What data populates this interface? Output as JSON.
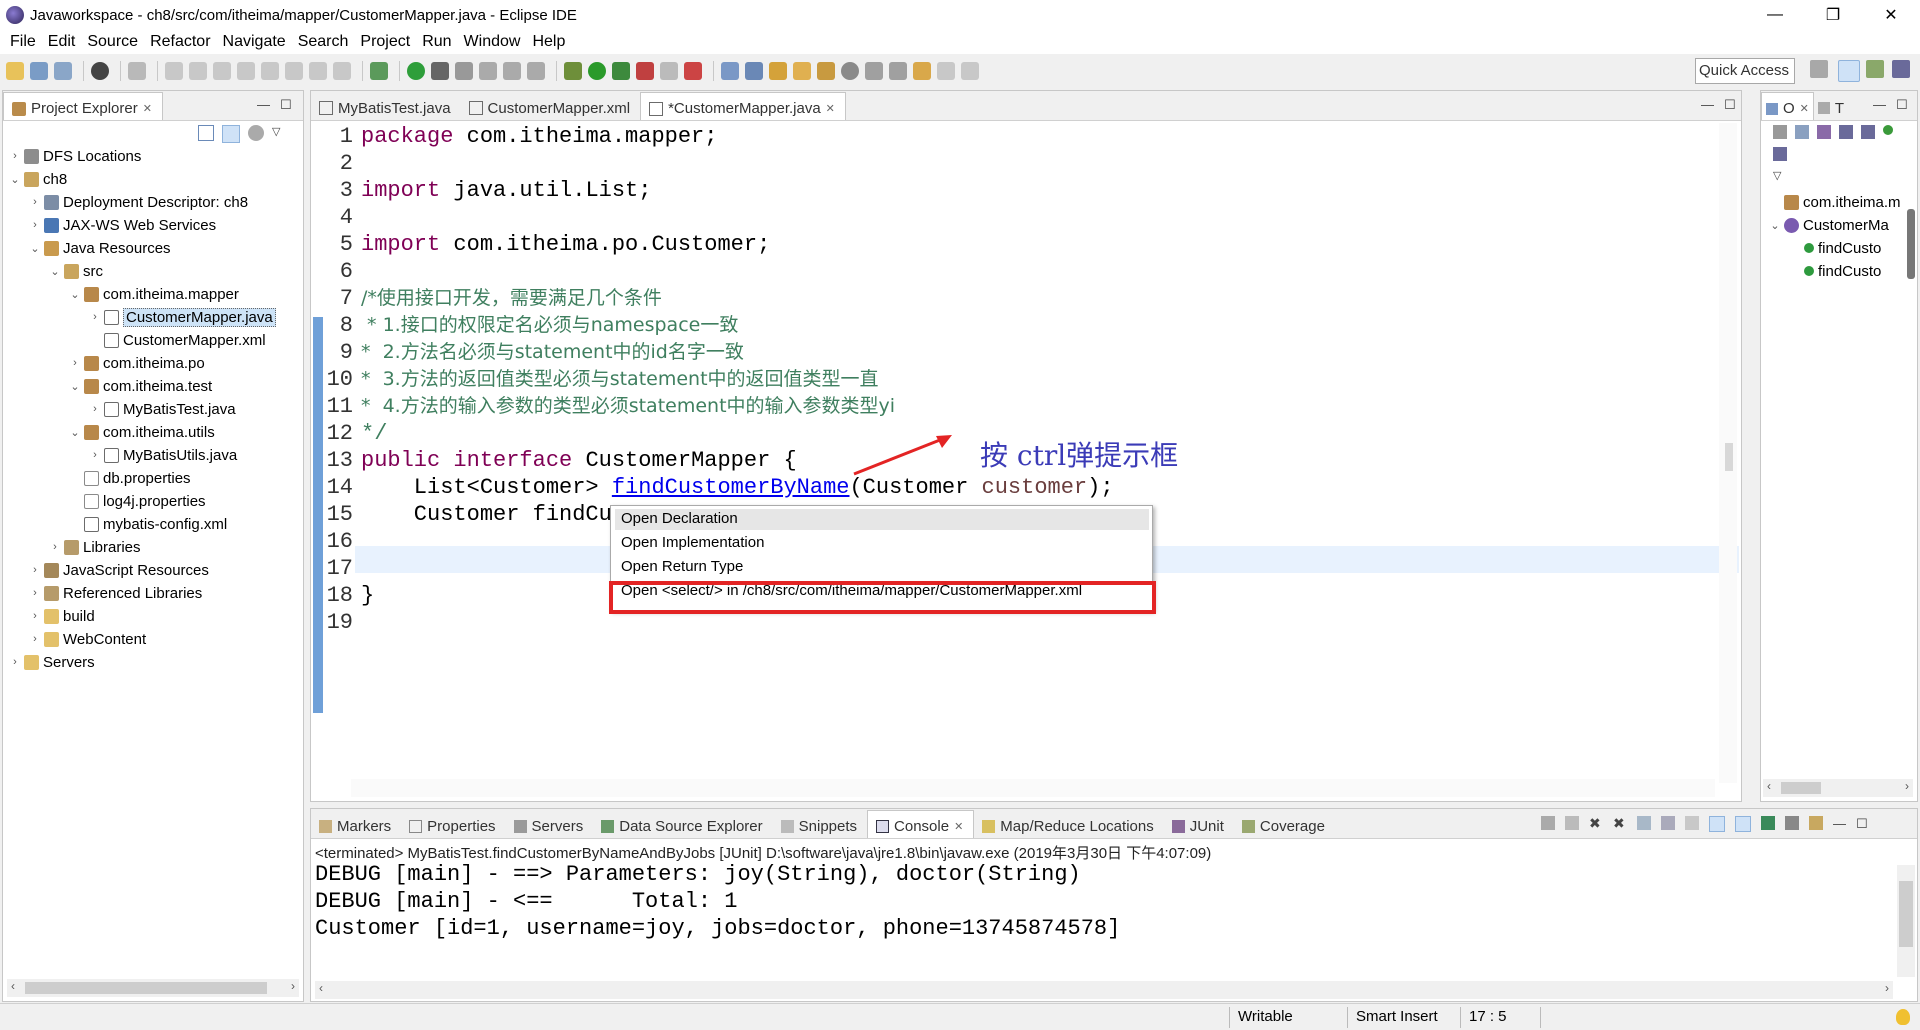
{
  "window": {
    "title": "Javaworkspace - ch8/src/com/itheima/mapper/CustomerMapper.java - Eclipse IDE",
    "minimize": "—",
    "maximize": "❐",
    "close": "✕"
  },
  "menu": [
    "File",
    "Edit",
    "Source",
    "Refactor",
    "Navigate",
    "Search",
    "Project",
    "Run",
    "Window",
    "Help"
  ],
  "toolbar": {
    "quick_access": "Quick Access"
  },
  "project_explorer": {
    "title": "Project Explorer",
    "items": [
      {
        "label": "DFS Locations",
        "icon": "dfs-icon"
      },
      {
        "label": "ch8",
        "icon": "project-icon"
      },
      {
        "label": "Deployment Descriptor: ch8",
        "icon": "deployment-descriptor-icon"
      },
      {
        "label": "JAX-WS Web Services",
        "icon": "web-services-icon"
      },
      {
        "label": "Java Resources",
        "icon": "java-resources-icon"
      },
      {
        "label": "src",
        "icon": "source-folder-icon"
      },
      {
        "label": "com.itheima.mapper",
        "icon": "package-icon"
      },
      {
        "label": "CustomerMapper.java",
        "icon": "java-file-icon"
      },
      {
        "label": "CustomerMapper.xml",
        "icon": "xml-file-icon"
      },
      {
        "label": "com.itheima.po",
        "icon": "package-icon"
      },
      {
        "label": "com.itheima.test",
        "icon": "package-icon"
      },
      {
        "label": "MyBatisTest.java",
        "icon": "java-file-icon"
      },
      {
        "label": "com.itheima.utils",
        "icon": "package-icon"
      },
      {
        "label": "MyBatisUtils.java",
        "icon": "java-file-icon"
      },
      {
        "label": "db.properties",
        "icon": "properties-file-icon"
      },
      {
        "label": "log4j.properties",
        "icon": "properties-file-icon"
      },
      {
        "label": "mybatis-config.xml",
        "icon": "xml-file-icon"
      },
      {
        "label": "Libraries",
        "icon": "library-icon"
      },
      {
        "label": "JavaScript Resources",
        "icon": "javascript-resources-icon"
      },
      {
        "label": "Referenced Libraries",
        "icon": "library-icon"
      },
      {
        "label": "build",
        "icon": "folder-icon"
      },
      {
        "label": "WebContent",
        "icon": "folder-icon"
      },
      {
        "label": "Servers",
        "icon": "folder-icon"
      }
    ]
  },
  "editor": {
    "tabs": [
      {
        "label": "MyBatisTest.java"
      },
      {
        "label": "CustomerMapper.xml"
      },
      {
        "label": "*CustomerMapper.java"
      }
    ],
    "lines": [
      {
        "n": "1"
      },
      {
        "n": "2"
      },
      {
        "n": "3"
      },
      {
        "n": "4"
      },
      {
        "n": "5"
      },
      {
        "n": "6"
      },
      {
        "n": "7"
      },
      {
        "n": "8"
      },
      {
        "n": "9"
      },
      {
        "n": "10"
      },
      {
        "n": "11"
      },
      {
        "n": "12"
      },
      {
        "n": "13"
      },
      {
        "n": "14"
      },
      {
        "n": "15"
      },
      {
        "n": "16"
      },
      {
        "n": "17"
      },
      {
        "n": "18"
      },
      {
        "n": "19"
      }
    ],
    "code": {
      "l1_kw": "package",
      "l1_rest": " com.itheima.mapper;",
      "l3_kw": "import",
      "l3_rest": " java.util.List;",
      "l5_kw": "import",
      "l5_rest": " com.itheima.po.Customer;",
      "l7": "/*使用接口开发，需要满足几个条件",
      "l8": " * 1.接口的权限定名必须与namespace一致",
      "l9": "*  2.方法名必须与statement中的id名字一致",
      "l10": "*  3.方法的返回值类型必须与statement中的返回值类型一直",
      "l11": "*  4.方法的输入参数的类型必须statement中的输入参数类型yi",
      "l12": "*/",
      "l13_kw1": "public",
      "l13_kw2": "interface",
      "l13_rest": " CustomerMapper {",
      "l14_pre": "    List<Customer> ",
      "l14_link": "findCustomerByName",
      "l14_mid": "(Customer ",
      "l14_param": "customer",
      "l14_post": ");",
      "l15": "    Customer findCu",
      "l18": "}"
    }
  },
  "hyperlink_popup": {
    "items": [
      "Open Declaration",
      "Open Implementation",
      "Open Return Type",
      "Open <select/> in /ch8/src/com/itheima/mapper/CustomerMapper.xml"
    ]
  },
  "annotation": {
    "text": "按 ctrl弹提示框",
    "color": "#e32424"
  },
  "outline": {
    "tab1": "O",
    "tab2": "T",
    "items": [
      {
        "label": "com.itheima.m",
        "icon": "import-icon"
      },
      {
        "label": "CustomerMa",
        "icon": "interface-icon"
      },
      {
        "label": "findCusto",
        "icon": "method-icon"
      },
      {
        "label": "findCusto",
        "icon": "method-icon"
      }
    ]
  },
  "bottom_panel": {
    "tabs": [
      "Markers",
      "Properties",
      "Servers",
      "Data Source Explorer",
      "Snippets",
      "Console",
      "Map/Reduce Locations",
      "JUnit",
      "Coverage"
    ],
    "terminated": "<terminated> MyBatisTest.findCustomerByNameAndByJobs [JUnit] D:\\software\\java\\jre1.8\\bin\\javaw.exe (2019年3月30日 下午4:07:09)",
    "console_lines": [
      "DEBUG [main] - ==> Parameters: joy(String), doctor(String)",
      "DEBUG [main] - <==      Total: 1",
      "Customer [id=1, username=joy, jobs=doctor, phone=13745874578]"
    ]
  },
  "status": {
    "writable": "Writable",
    "insert_mode": "Smart Insert",
    "position": "17 : 5"
  }
}
